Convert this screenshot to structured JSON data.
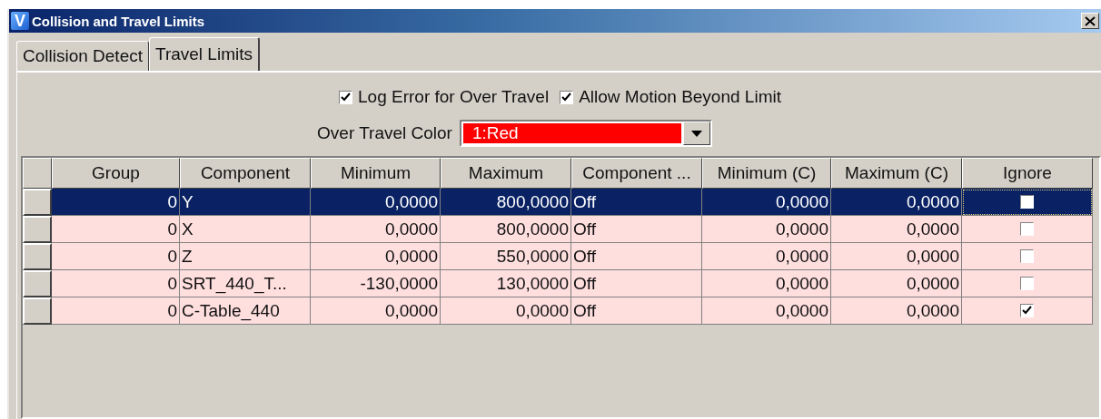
{
  "window": {
    "icon_letter": "V",
    "title": "Collision and Travel Limits"
  },
  "tabs": [
    {
      "label": "Collision Detect",
      "selected": false
    },
    {
      "label": "Travel Limits",
      "selected": true
    }
  ],
  "options": [
    {
      "label": "Log Error for Over Travel",
      "checked": true
    },
    {
      "label": "Allow Motion Beyond Limit",
      "checked": true
    }
  ],
  "color_field": {
    "label": "Over Travel Color",
    "value": "1:Red",
    "color": "#ff0000"
  },
  "table": {
    "columns": [
      {
        "label": "Group"
      },
      {
        "label": "Component"
      },
      {
        "label": "Minimum"
      },
      {
        "label": "Maximum"
      },
      {
        "label": "Component ..."
      },
      {
        "label": "Minimum (C)"
      },
      {
        "label": "Maximum (C)"
      },
      {
        "label": "Ignore"
      }
    ],
    "rows": [
      {
        "selected": true,
        "cells": [
          "0",
          "Y",
          "0,0000",
          "800,0000",
          "Off",
          "0,0000",
          "0,0000"
        ],
        "ignore": false
      },
      {
        "selected": false,
        "cells": [
          "0",
          "X",
          "0,0000",
          "800,0000",
          "Off",
          "0,0000",
          "0,0000"
        ],
        "ignore": false
      },
      {
        "selected": false,
        "cells": [
          "0",
          "Z",
          "0,0000",
          "550,0000",
          "Off",
          "0,0000",
          "0,0000"
        ],
        "ignore": false
      },
      {
        "selected": false,
        "cells": [
          "0",
          "SRT_440_T...",
          "-130,0000",
          "130,0000",
          "Off",
          "0,0000",
          "0,0000"
        ],
        "ignore": false
      },
      {
        "selected": false,
        "cells": [
          "0",
          "C-Table_440",
          "0,0000",
          "0,0000",
          "Off",
          "0,0000",
          "0,0000"
        ],
        "ignore": true
      }
    ]
  }
}
